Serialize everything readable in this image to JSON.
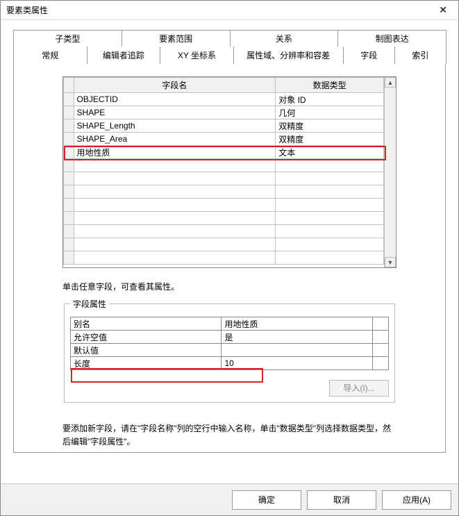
{
  "window": {
    "title": "要素类属性"
  },
  "tabs_top": [
    {
      "label": "子类型"
    },
    {
      "label": "要素范围"
    },
    {
      "label": "关系"
    },
    {
      "label": "制图表达"
    }
  ],
  "tabs_bottom": [
    {
      "label": "常规"
    },
    {
      "label": "编辑者追踪"
    },
    {
      "label": "XY 坐标系"
    },
    {
      "label": "属性域、分辨率和容差"
    },
    {
      "label": "字段",
      "active": true
    },
    {
      "label": "索引"
    }
  ],
  "fields_table": {
    "headers": {
      "name": "字段名",
      "type": "数据类型"
    },
    "rows": [
      {
        "name": "OBJECTID",
        "type": "对象 ID"
      },
      {
        "name": "SHAPE",
        "type": "几何"
      },
      {
        "name": "SHAPE_Length",
        "type": "双精度"
      },
      {
        "name": "SHAPE_Area",
        "type": "双精度"
      },
      {
        "name": "用地性质",
        "type": "文本",
        "highlight": true
      }
    ],
    "empty_rows": 8
  },
  "hint": "单击任意字段，可查看其属性。",
  "props": {
    "legend": "字段属性",
    "rows": [
      {
        "label": "别名",
        "value": "用地性质"
      },
      {
        "label": "允许空值",
        "value": "是"
      },
      {
        "label": "默认值",
        "value": ""
      },
      {
        "label": "长度",
        "value": "10",
        "highlight": true
      }
    ]
  },
  "import_btn": "导入(I)...",
  "instructions": "要添加新字段，请在\"字段名称\"列的空行中输入名称，单击\"数据类型\"列选择数据类型，然后编辑\"字段属性\"。",
  "footer": {
    "ok": "确定",
    "cancel": "取消",
    "apply": "应用(A)"
  }
}
